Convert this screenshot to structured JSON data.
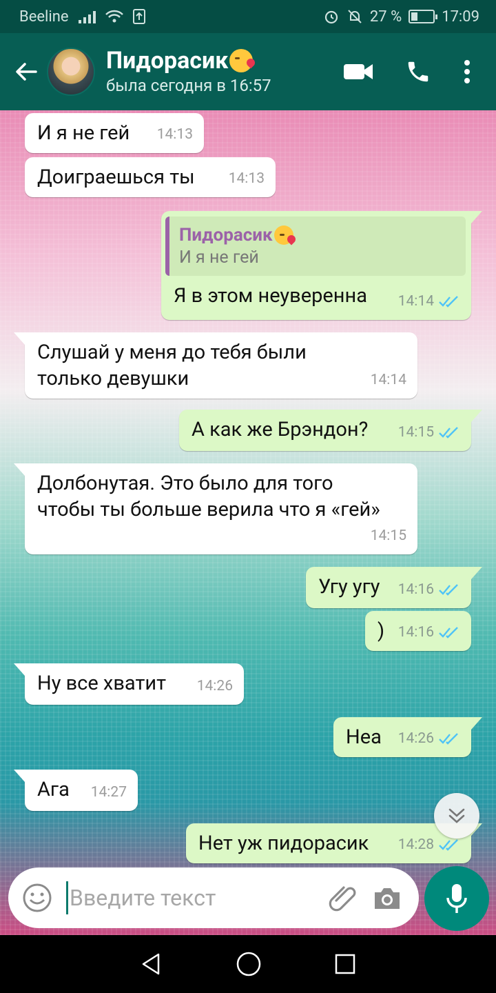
{
  "status_bar": {
    "carrier": "Beeline",
    "battery": "27 %",
    "time": "17:09"
  },
  "header": {
    "contact_name": "Пидорасик",
    "last_seen": "была сегодня в 16:57"
  },
  "messages": [
    {
      "dir": "in",
      "text": "И я не гей",
      "time": "14:13"
    },
    {
      "dir": "in",
      "text": "Доиграешься ты",
      "time": "14:13"
    },
    {
      "dir": "out",
      "reply_to_name": "Пидорасик",
      "reply_to_text": "И я не гей",
      "text": "Я в этом неуверенна",
      "time": "14:14"
    },
    {
      "dir": "in",
      "text": "Слушай у меня до тебя были только девушки",
      "time": "14:14"
    },
    {
      "dir": "out",
      "text": "А как же Брэндон?",
      "time": "14:15"
    },
    {
      "dir": "in",
      "text": "Долбонутая. Это было для того чтобы ты больше верила что я «гей»",
      "time": "14:15"
    },
    {
      "dir": "out",
      "text": "Угу угу",
      "time": "14:16"
    },
    {
      "dir": "out",
      "text": ")",
      "time": "14:16"
    },
    {
      "dir": "in",
      "text": "Ну все хватит",
      "time": "14:26"
    },
    {
      "dir": "out",
      "text": "Неа",
      "time": "14:26"
    },
    {
      "dir": "in",
      "text": "Ага",
      "time": "14:27"
    },
    {
      "dir": "out",
      "text": "Нет уж пидорасик",
      "time": "14:28"
    }
  ],
  "composer": {
    "placeholder": "Введите текст"
  },
  "colors": {
    "header": "#075e54",
    "status_bar": "#054d44",
    "outgoing_bubble": "#dcf8c6",
    "incoming_bubble": "#ffffff",
    "read_ticks": "#4fc3f7",
    "mic_button": "#00897b"
  },
  "icons": [
    "back-arrow-icon",
    "video-call-icon",
    "phone-icon",
    "more-vert-icon",
    "double-check-icon",
    "scroll-down-icon",
    "emoji-icon",
    "attach-icon",
    "camera-icon",
    "mic-icon",
    "nav-back-icon",
    "nav-home-icon",
    "nav-recents-icon",
    "alarm-icon",
    "mute-icon",
    "battery-icon",
    "signal-icon",
    "wifi-icon"
  ]
}
